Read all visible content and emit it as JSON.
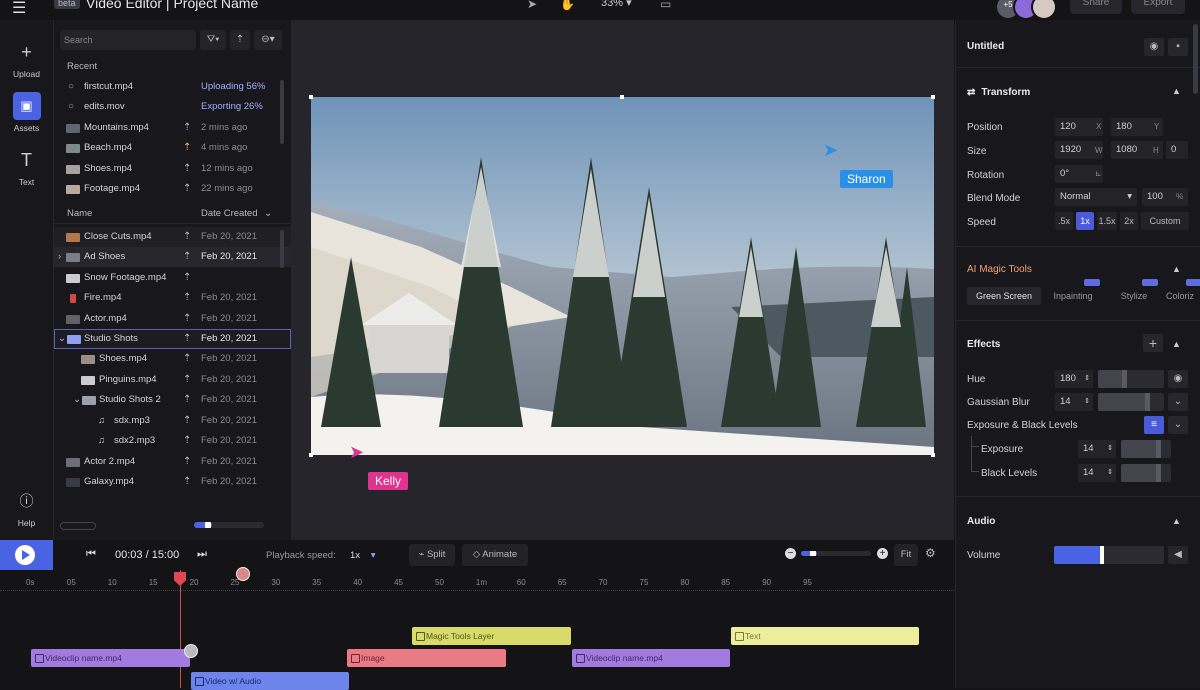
{
  "header": {
    "menu_icon": "menu-icon",
    "badge": "beta",
    "app_title": "Video Editor |",
    "project": "Project Name",
    "zoom": "33%",
    "avatar_count": "+5",
    "share": "Share",
    "export": "Export"
  },
  "rail": {
    "upload": "Upload",
    "assets": "Assets",
    "text": "Text",
    "help": "Help"
  },
  "assets": {
    "search_placeholder": "Search",
    "recent_label": "Recent",
    "recent": [
      {
        "name": "firstcut.mp4",
        "status": "Uploading 56%",
        "progress": 0.56
      },
      {
        "name": "edits.mov",
        "status": "Exporting 26%",
        "progress": 0.26
      },
      {
        "name": "Mountains.mp4",
        "time": "2 mins ago"
      },
      {
        "name": "Beach.mp4",
        "time": "4 mins ago"
      },
      {
        "name": "Shoes.mp4",
        "time": "12 mins ago"
      },
      {
        "name": "Footage.mp4",
        "time": "22 mins ago"
      }
    ],
    "col_name": "Name",
    "col_date": "Date Created",
    "files": [
      {
        "name": "Close Cuts.mp4",
        "date": "Feb 20, 2021"
      },
      {
        "name": "Ad Shoes",
        "date": "Feb 20, 2021"
      },
      {
        "name": "Snow Footage.mp4",
        "date": ""
      },
      {
        "name": "Fire.mp4",
        "date": "Feb 20, 2021"
      },
      {
        "name": "Actor.mp4",
        "date": "Feb 20, 2021"
      },
      {
        "name": "Studio Shots",
        "date": "Feb 20, 2021"
      },
      {
        "name": "Shoes.mp4",
        "date": "Feb 20, 2021"
      },
      {
        "name": "Pinguins.mp4",
        "date": "Feb 20, 2021"
      },
      {
        "name": "Studio Shots 2",
        "date": "Feb 20, 2021"
      },
      {
        "name": "sdx.mp3",
        "date": "Feb 20, 2021"
      },
      {
        "name": "sdx2.mp3",
        "date": "Feb 20, 2021"
      },
      {
        "name": "Actor 2.mp4",
        "date": "Feb 20, 2021"
      },
      {
        "name": "Galaxy.mp4",
        "date": "Feb 20, 2021"
      }
    ]
  },
  "canvas": {
    "cursor1": "Sharon",
    "cursor2": "Kelly"
  },
  "properties": {
    "title": "Untitled",
    "transform_title": "Transform",
    "position_label": "Position",
    "pos_x": "120",
    "pos_x_unit": "X",
    "pos_y": "180",
    "pos_y_unit": "Y",
    "size_label": "Size",
    "size_w": "1920",
    "size_w_unit": "W",
    "size_h": "1080",
    "size_h_unit": "H",
    "size_extra": "0",
    "rotation_label": "Rotation",
    "rotation": "0°",
    "blend_label": "Blend Mode",
    "blend": "Normal",
    "opacity": "100",
    "opacity_unit": "%",
    "speed_label": "Speed",
    "speeds": [
      ".5x",
      "1x",
      "1.5x",
      "2x",
      "Custom"
    ],
    "ai_title": "AI Magic Tools",
    "ai_tabs": [
      "Green Screen",
      "Inpainting",
      "Stylize",
      "Coloriz"
    ],
    "effects_title": "Effects",
    "hue_label": "Hue",
    "hue": "180",
    "hue_level": 0.42,
    "blur_label": "Gaussian Blur",
    "blur": "14",
    "blur_level": 0.78,
    "exposure_group": "Exposure & Black Levels",
    "exposure_label": "Exposure",
    "exposure": "14",
    "exposure_level": 0.78,
    "black_label": "Black Levels",
    "black": "14",
    "black_level": 0.78,
    "audio_title": "Audio",
    "volume_label": "Volume",
    "volume_level": 0.45
  },
  "transport": {
    "time": "00:03 / 15:00",
    "speed_label": "Playback speed:",
    "speed_value": "1x",
    "split": "Split",
    "animate": "Animate",
    "fit": "Fit"
  },
  "timeline": {
    "ticks": [
      "0s",
      "05",
      "10",
      "15",
      "20",
      "25",
      "30",
      "35",
      "40",
      "45",
      "50",
      "1m",
      "60",
      "65",
      "70",
      "75",
      "80",
      "85",
      "90",
      "95"
    ],
    "clips": [
      {
        "label": "Magic Tools Layer",
        "color": "#d8da6a",
        "text": "#55561b"
      },
      {
        "label": "Text",
        "color": "#ecee9c",
        "text": "#77783a"
      },
      {
        "label": "Videoclip name.mp4",
        "color": "#a17be0",
        "text": "#3d2a63"
      },
      {
        "label": "Image",
        "color": "#ea7a85",
        "text": "#6a2530"
      },
      {
        "label": "Videoclip name.mp4",
        "color": "#a17be0",
        "text": "#3d2a63"
      },
      {
        "label": "Video w/ Audio",
        "color": "#6c84ec",
        "text": "#1f2a66"
      }
    ]
  },
  "colors": {
    "accent": "#4a63e3",
    "sharon": "#2b8fe8",
    "kelly": "#e0338f"
  }
}
